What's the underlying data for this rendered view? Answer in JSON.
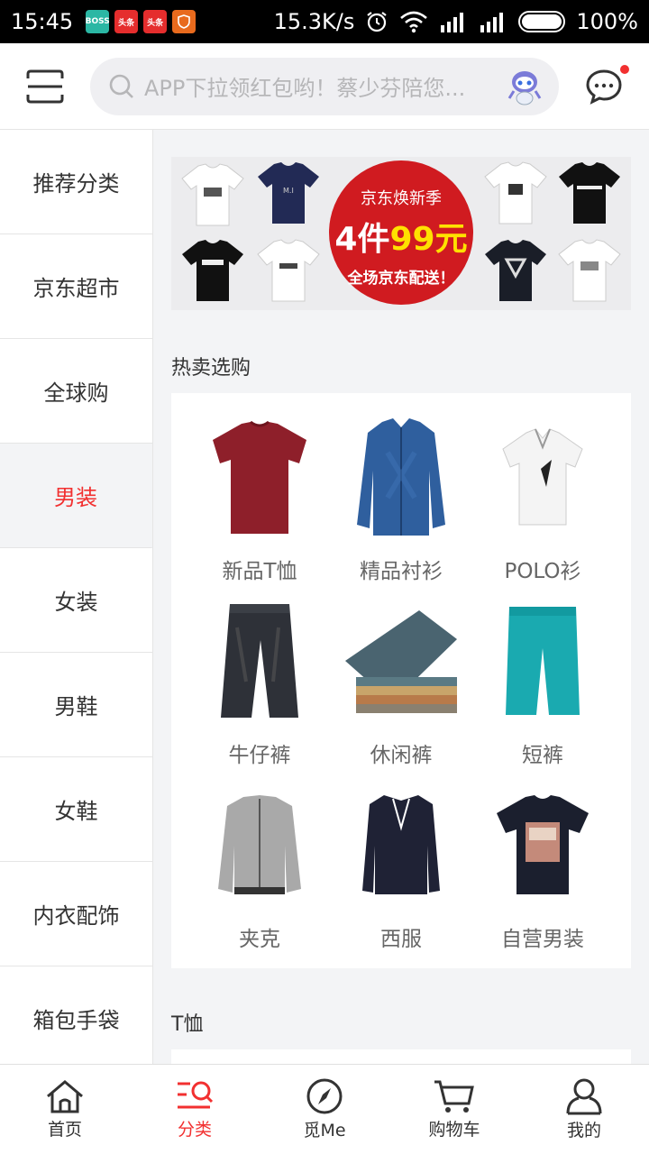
{
  "status": {
    "time": "15:45",
    "speed": "15.3K/s",
    "battery": "100%",
    "app_icons": [
      {
        "text": "BOSS\n直聘",
        "color": "#2bb7a4"
      },
      {
        "text": "头条",
        "color": "#e52d2d"
      },
      {
        "text": "头条",
        "color": "#e52d2d"
      },
      {
        "text": "",
        "color": "#e86a1d"
      }
    ]
  },
  "header": {
    "search_placeholder": "APP下拉领红包哟！蔡少芬陪您...",
    "menu_icon": "scan-menu-icon",
    "message_icon": "chat-bubble-icon",
    "badge_color": "#f23030"
  },
  "sidebar": {
    "items": [
      {
        "label": "推荐分类",
        "active": false
      },
      {
        "label": "京东超市",
        "active": false
      },
      {
        "label": "全球购",
        "active": false
      },
      {
        "label": "男装",
        "active": true
      },
      {
        "label": "女装",
        "active": false
      },
      {
        "label": "男鞋",
        "active": false
      },
      {
        "label": "女鞋",
        "active": false
      },
      {
        "label": "内衣配饰",
        "active": false
      },
      {
        "label": "箱包手袋",
        "active": false
      }
    ]
  },
  "banner": {
    "line1": "京东焕新季",
    "line2_prefix": "4件",
    "line2_price": "99元",
    "line3": "全场京东配送！",
    "shirt_texts": [
      "",
      "M.I",
      "",
      "FEBRUMISS",
      "SEWOOK",
      "",
      "",
      "",
      ""
    ]
  },
  "sections": {
    "hot_title": "热卖选购",
    "tshirt_title": "T恤"
  },
  "products": [
    {
      "label": "新品T恤",
      "icon": "red-tshirt-icon"
    },
    {
      "label": "精品衬衫",
      "icon": "denim-shirt-icon"
    },
    {
      "label": "POLO衫",
      "icon": "polo-shirt-icon"
    },
    {
      "label": "牛仔裤",
      "icon": "jeans-icon"
    },
    {
      "label": "休闲裤",
      "icon": "folded-pants-icon"
    },
    {
      "label": "短裤",
      "icon": "shorts-icon"
    },
    {
      "label": "夹克",
      "icon": "jacket-icon"
    },
    {
      "label": "西服",
      "icon": "suit-icon"
    },
    {
      "label": "自营男装",
      "icon": "printed-tshirt-icon"
    }
  ],
  "tabbar": {
    "items": [
      {
        "label": "首页",
        "icon": "home-icon",
        "active": false
      },
      {
        "label": "分类",
        "icon": "category-search-icon",
        "active": true
      },
      {
        "label": "觅Me",
        "icon": "compass-icon",
        "active": false
      },
      {
        "label": "购物车",
        "icon": "cart-icon",
        "active": false
      },
      {
        "label": "我的",
        "icon": "user-icon",
        "active": false
      }
    ]
  },
  "colors": {
    "accent": "#f23030",
    "background": "#f3f4f6"
  }
}
